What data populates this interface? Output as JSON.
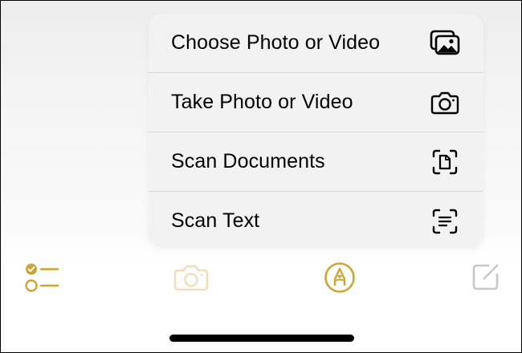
{
  "menu": {
    "items": [
      {
        "label": "Choose Photo or Video",
        "icon": "photo-library-icon"
      },
      {
        "label": "Take Photo or Video",
        "icon": "camera-icon"
      },
      {
        "label": "Scan Documents",
        "icon": "scan-document-icon"
      },
      {
        "label": "Scan Text",
        "icon": "scan-text-icon"
      }
    ]
  },
  "toolbar": {
    "buttons": [
      {
        "icon": "checklist-icon",
        "state": "active"
      },
      {
        "icon": "camera-icon",
        "state": "highlighted"
      },
      {
        "icon": "markup-pen-icon",
        "state": "active"
      },
      {
        "icon": "compose-icon",
        "state": "disabled"
      }
    ]
  },
  "colors": {
    "accent": "#d1a431",
    "accent_faded": "#eedfb8",
    "disabled": "#c7c7c7",
    "menu_background": "#f2f2f2",
    "separator": "#d6d6d6",
    "text": "#000000"
  }
}
